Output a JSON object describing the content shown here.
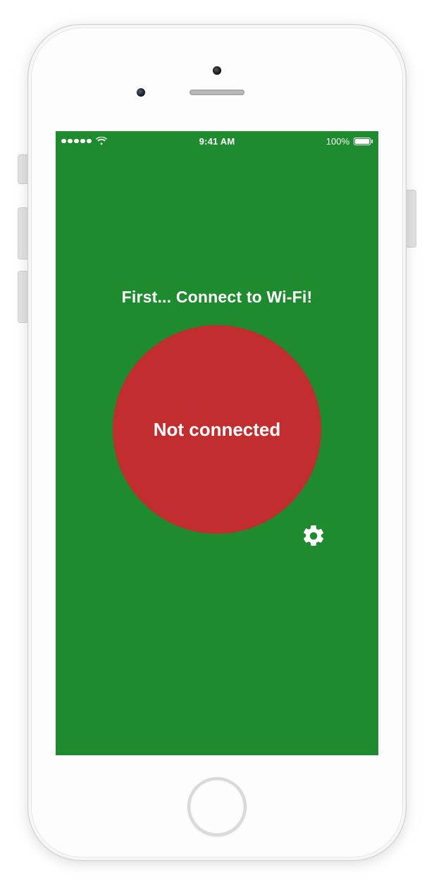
{
  "statusbar": {
    "time": "9:41 AM",
    "battery_text": "100%"
  },
  "heading": "First... Connect to Wi-Fi!",
  "status_circle_label": "Not connected",
  "colors": {
    "background": "#1e8b2f",
    "circle": "#c22d2f",
    "text": "#ffffff"
  }
}
